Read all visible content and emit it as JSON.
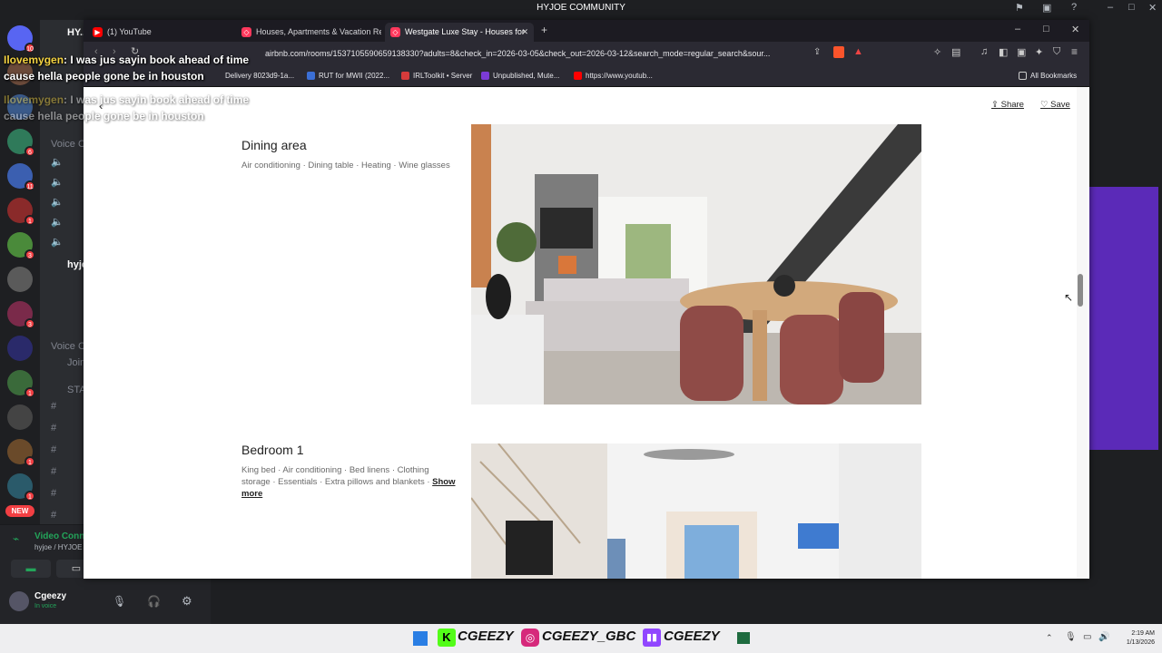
{
  "discord": {
    "window_title": "HYJOE COMMUNITY",
    "server_name": "HY..",
    "channel_sections": [
      "Voice Ch",
      "Voice Ch"
    ],
    "active_channel": "hyjo",
    "join_label": "Join",
    "stage_label": "STA",
    "voice_status": "Video Conn",
    "voice_sub": "hyjoe / HYJOE C",
    "username": "Cgeezy",
    "user_status": "In voice",
    "new_badge": "NEW",
    "guild_badges": [
      "10",
      "6",
      "11",
      "1",
      "3",
      "3",
      "1",
      "1",
      "1",
      "1"
    ]
  },
  "chat_overlay": [
    {
      "name": "Ilovemygen",
      "message": ": I was jus sayin book ahead of time",
      "line2": "cause hella people gone be in houston"
    },
    {
      "name": "Ilovemygen",
      "message": ": I was jus sayin book ahead of time",
      "line2": "cause hella people gone be in houston"
    }
  ],
  "browser": {
    "tabs": [
      {
        "label": "(1) YouTube",
        "icon": "youtube-icon",
        "color": "#ff0000"
      },
      {
        "label": "Houses, Apartments & Vacation Rent",
        "icon": "airbnb-icon",
        "color": "#ff385c"
      },
      {
        "label": "Westgate Luxe Stay - Houses for",
        "icon": "airbnb-icon",
        "color": "#ff385c",
        "active": true
      }
    ],
    "url": "airbnb.com/rooms/1537105590659138330?adults=8&check_in=2026-03-05&check_out=2026-03-12&search_mode=regular_search&sour...",
    "bookmarks": [
      {
        "label": "Delivery 8023d9-1a...",
        "color": "#888"
      },
      {
        "label": "RUT for MWII (2022...",
        "color": "#3b6fd6"
      },
      {
        "label": "IRLToolkit • Server",
        "color": "#d63b3b"
      },
      {
        "label": "Unpublished, Mute...",
        "color": "#7b3bd6"
      },
      {
        "label": "https://www.youtub...",
        "color": "#ff0000"
      }
    ],
    "all_bookmarks": "All Bookmarks"
  },
  "listing": {
    "share_label": "Share",
    "save_label": "Save",
    "sections": [
      {
        "title": "Dining area",
        "amenities": "Air conditioning · Dining table · Heating · Wine glasses"
      },
      {
        "title": "Bedroom 1",
        "amenities": "King bed · Air conditioning · Bed linens · Clothing storage · Essentials · Extra pillows and blankets · ",
        "show_more": "Show more"
      }
    ]
  },
  "taskbar": {
    "overlay_handles": [
      "CGEEZY",
      "CGEEZY_GBC",
      "CGEEZY"
    ],
    "time": "2:19 AM",
    "date": "1/13/2026"
  }
}
